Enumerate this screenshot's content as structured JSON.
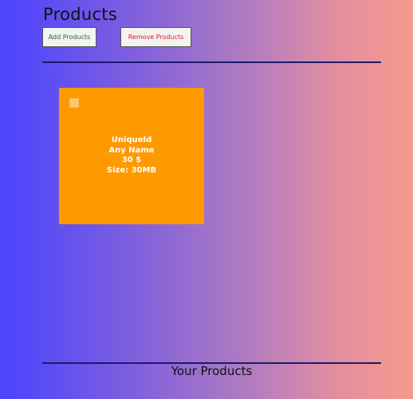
{
  "header": {
    "title": "Products",
    "add_label": "Add Products",
    "remove_label": "Remove Products"
  },
  "products": [
    {
      "id": "UniqueId",
      "name": "Any Name",
      "price": "30 $",
      "size": "Size: 30MB",
      "selected": false
    }
  ],
  "footer": {
    "title": "Your Products"
  },
  "colors": {
    "card_background": "#ff9900",
    "add_button_text": "#1c6b1c",
    "remove_button_text": "#e01a1a",
    "divider": "#1a1a6e"
  }
}
